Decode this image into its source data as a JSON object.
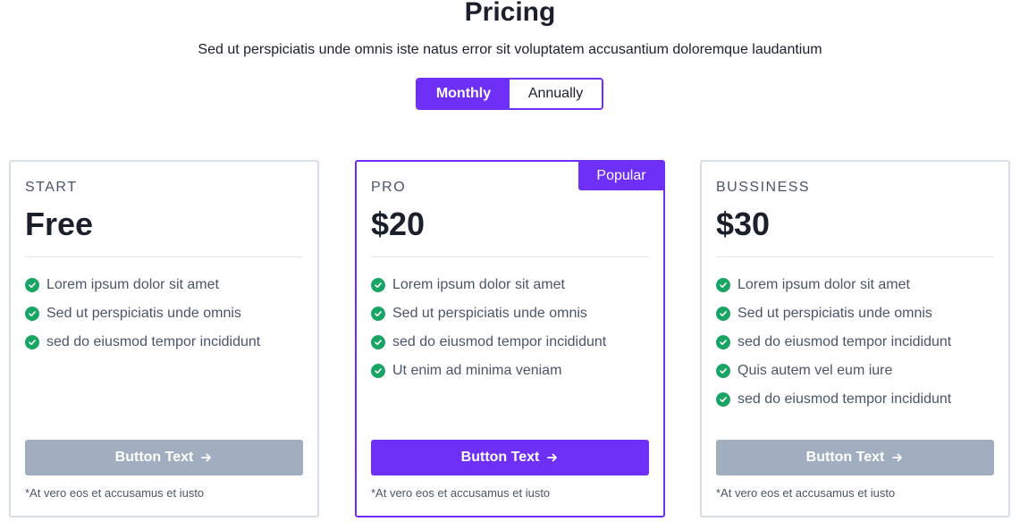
{
  "header": {
    "title": "Pricing",
    "subtitle": "Sed ut perspiciatis unde omnis iste natus error sit voluptatem accusantium doloremque laudantium"
  },
  "billing_toggle": {
    "options": [
      "Monthly",
      "Annually"
    ],
    "selected": "Monthly"
  },
  "colors": {
    "accent": "#6e2ff6",
    "check": "#17a465",
    "disabled_button": "#a0aec0",
    "card_border": "#d5dde6"
  },
  "plans": [
    {
      "name": "START",
      "price": "Free",
      "features": [
        "Lorem ipsum dolor sit amet",
        "Sed ut perspiciatis unde omnis",
        "sed do eiusmod tempor incididunt"
      ],
      "button_label": "Button Text",
      "note": "*At vero eos et accusamus et iusto"
    },
    {
      "name": "PRO",
      "price": "$20",
      "badge": "Popular",
      "features": [
        "Lorem ipsum dolor sit amet",
        "Sed ut perspiciatis unde omnis",
        "sed do eiusmod tempor incididunt",
        "Ut enim ad minima veniam"
      ],
      "button_label": "Button Text",
      "note": "*At vero eos et accusamus et iusto"
    },
    {
      "name": "BUSSINESS",
      "price": "$30",
      "features": [
        "Lorem ipsum dolor sit amet",
        "Sed ut perspiciatis unde omnis",
        "sed do eiusmod tempor incididunt",
        "Quis autem vel eum iure",
        "sed do eiusmod tempor incididunt"
      ],
      "button_label": "Button Text",
      "note": "*At vero eos et accusamus et iusto"
    }
  ],
  "icons": {
    "feature": "check-circle-icon",
    "button": "arrow-right-icon"
  }
}
